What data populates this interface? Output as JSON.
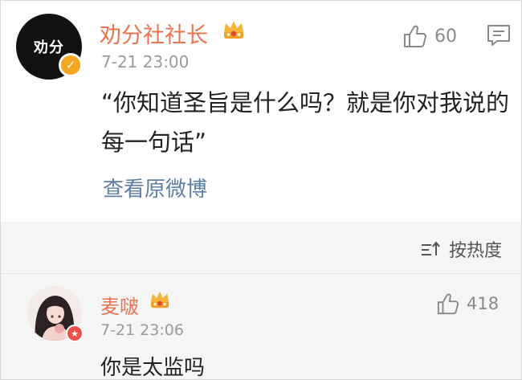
{
  "post": {
    "avatar_text": "劝分",
    "author": "劝分社社长",
    "time": "7-21 23:00",
    "likes": "60",
    "text": "“你知道圣旨是什么吗？就是你对我说的每一句话”",
    "view_original": "查看原微博",
    "icons": {
      "verify": "verified-badge-icon",
      "crown": "crown-icon",
      "like": "thumbs-up-icon",
      "comment": "comment-icon"
    }
  },
  "comments": {
    "sort_label": "按热度",
    "items": [
      {
        "author": "麦啵",
        "time": "7-21 23:06",
        "likes": "418",
        "text": "你是太监吗"
      }
    ]
  },
  "colors": {
    "name": "#eb7350",
    "link": "#5d7fa3",
    "meta": "#9a9a9a",
    "verify": "#f5a623",
    "section_bg": "#f5f5f5"
  }
}
